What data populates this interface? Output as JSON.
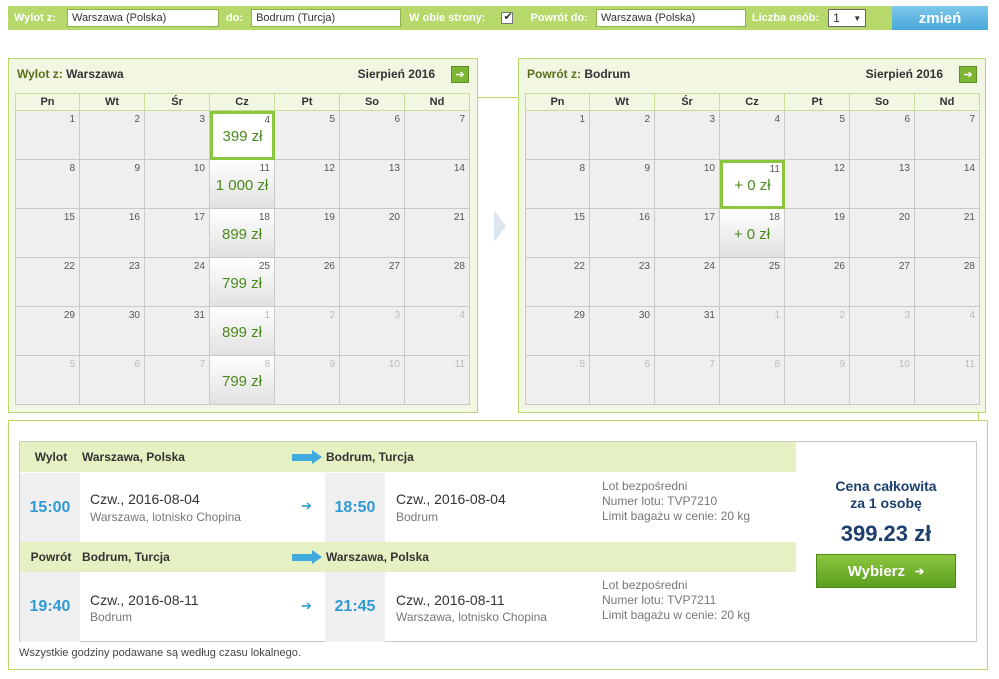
{
  "search": {
    "from_label": "Wylot z:",
    "from_value": "Warszawa (Polska)",
    "to_label": "do:",
    "to_value": "Bodrum (Turcja)",
    "roundtrip_label": "W obie strony:",
    "roundtrip_checked": true,
    "return_label": "Powrót do:",
    "return_value": "Warszawa (Polska)",
    "persons_label": "Liczba osób:",
    "persons_value": "1",
    "submit_label": "zmień"
  },
  "weekdays": [
    "Pn",
    "Wt",
    "Śr",
    "Cz",
    "Pt",
    "So",
    "Nd"
  ],
  "outbound_calendar": {
    "prefix": "Wylot z:",
    "city": "Warszawa",
    "month": "Sierpień 2016",
    "cells": [
      {
        "day": "1"
      },
      {
        "day": "2"
      },
      {
        "day": "3"
      },
      {
        "day": "4",
        "price": "399 zł",
        "selected": true
      },
      {
        "day": "5"
      },
      {
        "day": "6"
      },
      {
        "day": "7"
      },
      {
        "day": "8"
      },
      {
        "day": "9"
      },
      {
        "day": "10"
      },
      {
        "day": "11",
        "price": "1 000 zł"
      },
      {
        "day": "12"
      },
      {
        "day": "13"
      },
      {
        "day": "14"
      },
      {
        "day": "15"
      },
      {
        "day": "16"
      },
      {
        "day": "17"
      },
      {
        "day": "18",
        "price": "899 zł"
      },
      {
        "day": "19"
      },
      {
        "day": "20"
      },
      {
        "day": "21"
      },
      {
        "day": "22"
      },
      {
        "day": "23"
      },
      {
        "day": "24"
      },
      {
        "day": "25",
        "price": "799 zł"
      },
      {
        "day": "26"
      },
      {
        "day": "27"
      },
      {
        "day": "28"
      },
      {
        "day": "29"
      },
      {
        "day": "30"
      },
      {
        "day": "31"
      },
      {
        "day": "1",
        "price": "899 zł",
        "other": true
      },
      {
        "day": "2",
        "other": true
      },
      {
        "day": "3",
        "other": true
      },
      {
        "day": "4",
        "other": true
      },
      {
        "day": "5",
        "other": true
      },
      {
        "day": "6",
        "other": true
      },
      {
        "day": "7",
        "other": true
      },
      {
        "day": "8",
        "price": "799 zł",
        "other": true
      },
      {
        "day": "9",
        "other": true
      },
      {
        "day": "10",
        "other": true
      },
      {
        "day": "11",
        "other": true
      }
    ]
  },
  "return_calendar": {
    "prefix": "Powrót z:",
    "city": "Bodrum",
    "month": "Sierpień 2016",
    "cells": [
      {
        "day": "1"
      },
      {
        "day": "2"
      },
      {
        "day": "3"
      },
      {
        "day": "4"
      },
      {
        "day": "5"
      },
      {
        "day": "6"
      },
      {
        "day": "7"
      },
      {
        "day": "8"
      },
      {
        "day": "9"
      },
      {
        "day": "10"
      },
      {
        "day": "11",
        "price": "+ 0 zł",
        "selected": true
      },
      {
        "day": "12"
      },
      {
        "day": "13"
      },
      {
        "day": "14"
      },
      {
        "day": "15"
      },
      {
        "day": "16"
      },
      {
        "day": "17"
      },
      {
        "day": "18",
        "price": "+ 0 zł"
      },
      {
        "day": "19"
      },
      {
        "day": "20"
      },
      {
        "day": "21"
      },
      {
        "day": "22"
      },
      {
        "day": "23"
      },
      {
        "day": "24"
      },
      {
        "day": "25"
      },
      {
        "day": "26"
      },
      {
        "day": "27"
      },
      {
        "day": "28"
      },
      {
        "day": "29"
      },
      {
        "day": "30"
      },
      {
        "day": "31"
      },
      {
        "day": "1",
        "other": true
      },
      {
        "day": "2",
        "other": true
      },
      {
        "day": "3",
        "other": true
      },
      {
        "day": "4",
        "other": true
      },
      {
        "day": "5",
        "other": true
      },
      {
        "day": "6",
        "other": true
      },
      {
        "day": "7",
        "other": true
      },
      {
        "day": "8",
        "other": true
      },
      {
        "day": "9",
        "other": true
      },
      {
        "day": "10",
        "other": true
      },
      {
        "day": "11",
        "other": true
      }
    ]
  },
  "outbound": {
    "label": "Wylot",
    "from": "Warszawa, Polska",
    "to": "Bodrum, Turcja",
    "dep_time": "15:00",
    "dep_date": "Czw., 2016-08-04",
    "dep_place": "Warszawa, lotnisko Chopina",
    "arr_time": "18:50",
    "arr_date": "Czw., 2016-08-04",
    "arr_place": "Bodrum",
    "info1": "Lot bezpośredni",
    "info2": "Numer lotu: TVP7210",
    "info3": "Limit bagażu w cenie: 20 kg"
  },
  "return": {
    "label": "Powrót",
    "from": "Bodrum, Turcja",
    "to": "Warszawa, Polska",
    "dep_time": "19:40",
    "dep_date": "Czw., 2016-08-11",
    "dep_place": "Bodrum",
    "arr_time": "21:45",
    "arr_date": "Czw., 2016-08-11",
    "arr_place": "Warszawa, lotnisko Chopina",
    "info1": "Lot bezpośredni",
    "info2": "Numer lotu: TVP7211",
    "info3": "Limit bagażu w cenie: 20 kg"
  },
  "summary": {
    "title_line1": "Cena całkowita",
    "title_line2": "za 1 osobę",
    "price": "399.23 zł",
    "select_label": "Wybierz"
  },
  "footnote": "Wszystkie godziny podawane są według czasu lokalnego.",
  "colors": {
    "accent_green": "#b7d96b",
    "price_green": "#4a8a1c",
    "time_blue": "#2f9ad6",
    "total_navy": "#1d3f6e"
  }
}
